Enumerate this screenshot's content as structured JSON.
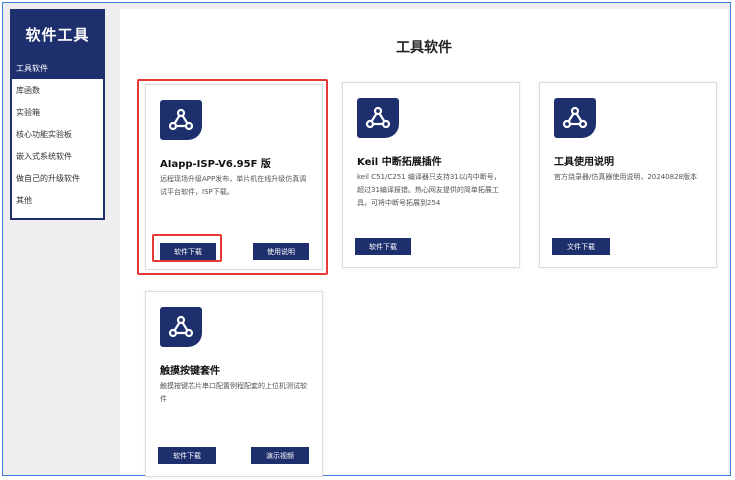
{
  "sidebar": {
    "title": "软件工具",
    "items": [
      {
        "label": "工具软件"
      },
      {
        "label": "库函数"
      },
      {
        "label": "实验箱"
      },
      {
        "label": "核心功能实验板"
      },
      {
        "label": "嵌入式系统软件"
      },
      {
        "label": "做自己的升级软件"
      },
      {
        "label": "其他"
      }
    ]
  },
  "main": {
    "title": "工具软件",
    "cards": [
      {
        "title": "AIapp-ISP-V6.95F 版",
        "desc": "远程现场升级APP发布，单片机在线升级仿真调试平台软件，ISP下载。",
        "buttons": [
          "软件下载",
          "使用说明"
        ]
      },
      {
        "title": "Keil 中断拓展插件",
        "desc": "keil C51/C251 编译器只支持31以内中断号，超过31编译报错。热心网友提供的简单拓展工具，可将中断号拓展到254",
        "buttons": [
          "软件下载"
        ]
      },
      {
        "title": "工具使用说明",
        "desc": "官方烧录器/仿真器使用说明，20240828版本",
        "buttons": [
          "文件下载"
        ]
      },
      {
        "title": "触摸按键套件",
        "desc": "触摸按键芯片串口配置例程配套的上位机测试软件",
        "buttons": [
          "软件下载",
          "演示视频"
        ]
      }
    ]
  },
  "colors": {
    "brand": "#1e2f6e",
    "highlight": "#e53935",
    "frame_border": "#3f7fd9"
  },
  "icons": {
    "card_icon": "share-nodes-icon"
  }
}
